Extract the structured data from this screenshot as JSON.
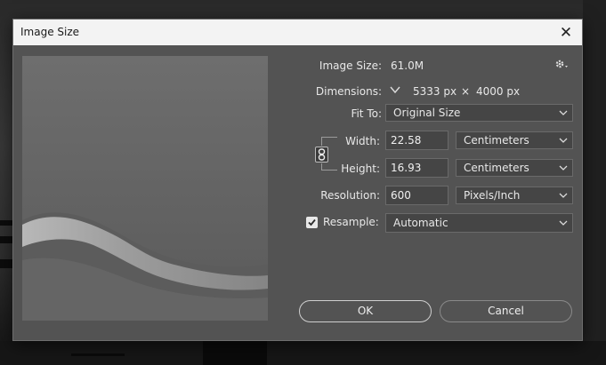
{
  "dialog": {
    "title": "Image Size",
    "close_glyph": "✕"
  },
  "image_size": {
    "label": "Image Size:",
    "value": "61.0M"
  },
  "dimensions": {
    "label": "Dimensions:",
    "width": "5333 px",
    "times": "×",
    "height": "4000 px"
  },
  "fit_to": {
    "label": "Fit To:",
    "value": "Original Size"
  },
  "width": {
    "label": "Width:",
    "value": "22.58",
    "unit": "Centimeters"
  },
  "height": {
    "label": "Height:",
    "value": "16.93",
    "unit": "Centimeters"
  },
  "resolution": {
    "label": "Resolution:",
    "value": "600",
    "unit": "Pixels/Inch"
  },
  "resample": {
    "label": "Resample:",
    "value": "Automatic",
    "checked": true
  },
  "buttons": {
    "ok": "OK",
    "cancel": "Cancel"
  },
  "icons": {
    "gear": "gear-icon",
    "link": "link-icon",
    "check": "checkmark-icon",
    "chevron": "chevron-down-icon"
  },
  "colors": {
    "dialog_bg": "#535353",
    "titlebar_bg": "#f3f3f3",
    "field_bg": "#454545"
  }
}
